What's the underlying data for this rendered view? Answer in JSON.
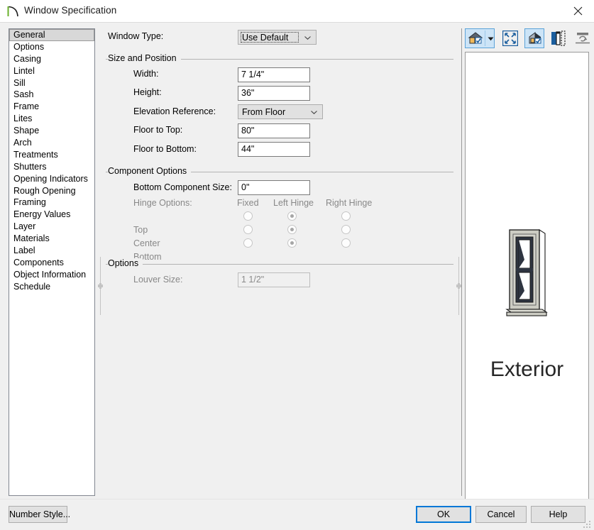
{
  "window": {
    "title": "Window Specification",
    "icon": "window-swing-icon",
    "close_label": "✕"
  },
  "sidebar": {
    "items": [
      {
        "label": "General",
        "selected": true
      },
      {
        "label": "Options",
        "selected": false
      },
      {
        "label": "Casing",
        "selected": false
      },
      {
        "label": "Lintel",
        "selected": false
      },
      {
        "label": "Sill",
        "selected": false
      },
      {
        "label": "Sash",
        "selected": false
      },
      {
        "label": "Frame",
        "selected": false
      },
      {
        "label": "Lites",
        "selected": false
      },
      {
        "label": "Shape",
        "selected": false
      },
      {
        "label": "Arch",
        "selected": false
      },
      {
        "label": "Treatments",
        "selected": false
      },
      {
        "label": "Shutters",
        "selected": false
      },
      {
        "label": "Opening Indicators",
        "selected": false
      },
      {
        "label": "Rough Opening",
        "selected": false
      },
      {
        "label": "Framing",
        "selected": false
      },
      {
        "label": "Energy Values",
        "selected": false
      },
      {
        "label": "Layer",
        "selected": false
      },
      {
        "label": "Materials",
        "selected": false
      },
      {
        "label": "Label",
        "selected": false
      },
      {
        "label": "Components",
        "selected": false
      },
      {
        "label": "Object Information",
        "selected": false
      },
      {
        "label": "Schedule",
        "selected": false
      }
    ]
  },
  "form": {
    "window_type": {
      "label": "Window Type:",
      "value": "Use Default",
      "focused": true
    },
    "size_and_position": {
      "title": "Size and Position",
      "width": {
        "label": "Width:",
        "value": "7 1/4\""
      },
      "height": {
        "label": "Height:",
        "value": "36\""
      },
      "elevation_reference": {
        "label": "Elevation Reference:",
        "value": "From Floor"
      },
      "floor_to_top": {
        "label": "Floor to Top:",
        "value": "80\""
      },
      "floor_to_bottom": {
        "label": "Floor to Bottom:",
        "value": "44\""
      }
    },
    "component_options": {
      "title": "Component Options",
      "bottom_component_size": {
        "label": "Bottom Component Size:",
        "value": "0\""
      },
      "hinge_options": {
        "label": "Hinge Options:",
        "columns": [
          "Fixed",
          "Left Hinge",
          "Right Hinge"
        ],
        "rows": [
          {
            "label": "Top",
            "selected": "Left Hinge"
          },
          {
            "label": "Center",
            "selected": "Left Hinge"
          },
          {
            "label": "Bottom",
            "selected": "Left Hinge"
          }
        ],
        "disabled": true
      }
    },
    "options": {
      "title": "Options",
      "louver_size": {
        "label": "Louver Size:",
        "value": "1 1/2\"",
        "disabled": true
      }
    }
  },
  "preview": {
    "toolbar": [
      {
        "name": "view-house-dropdown-button",
        "icon": "house-check-icon",
        "active": true
      },
      {
        "name": "fill-window-button",
        "icon": "expand-arrows-icon",
        "active": false
      },
      {
        "name": "orthographic-view-button",
        "icon": "house-section-check-icon",
        "active": true
      },
      {
        "name": "cross-section-button",
        "icon": "wall-section-icon",
        "active": false
      },
      {
        "name": "sync-camera-button",
        "icon": "refresh-camera-icon",
        "active": false
      }
    ],
    "label": "Exterior"
  },
  "footer": {
    "number_style": "Number Style...",
    "ok": "OK",
    "cancel": "Cancel",
    "help": "Help"
  },
  "colors": {
    "accent": "#0078d7",
    "toolbar_active": "#cce4f7",
    "dialog_bg": "#f0f0f0",
    "selection": "#d8d8d8"
  }
}
